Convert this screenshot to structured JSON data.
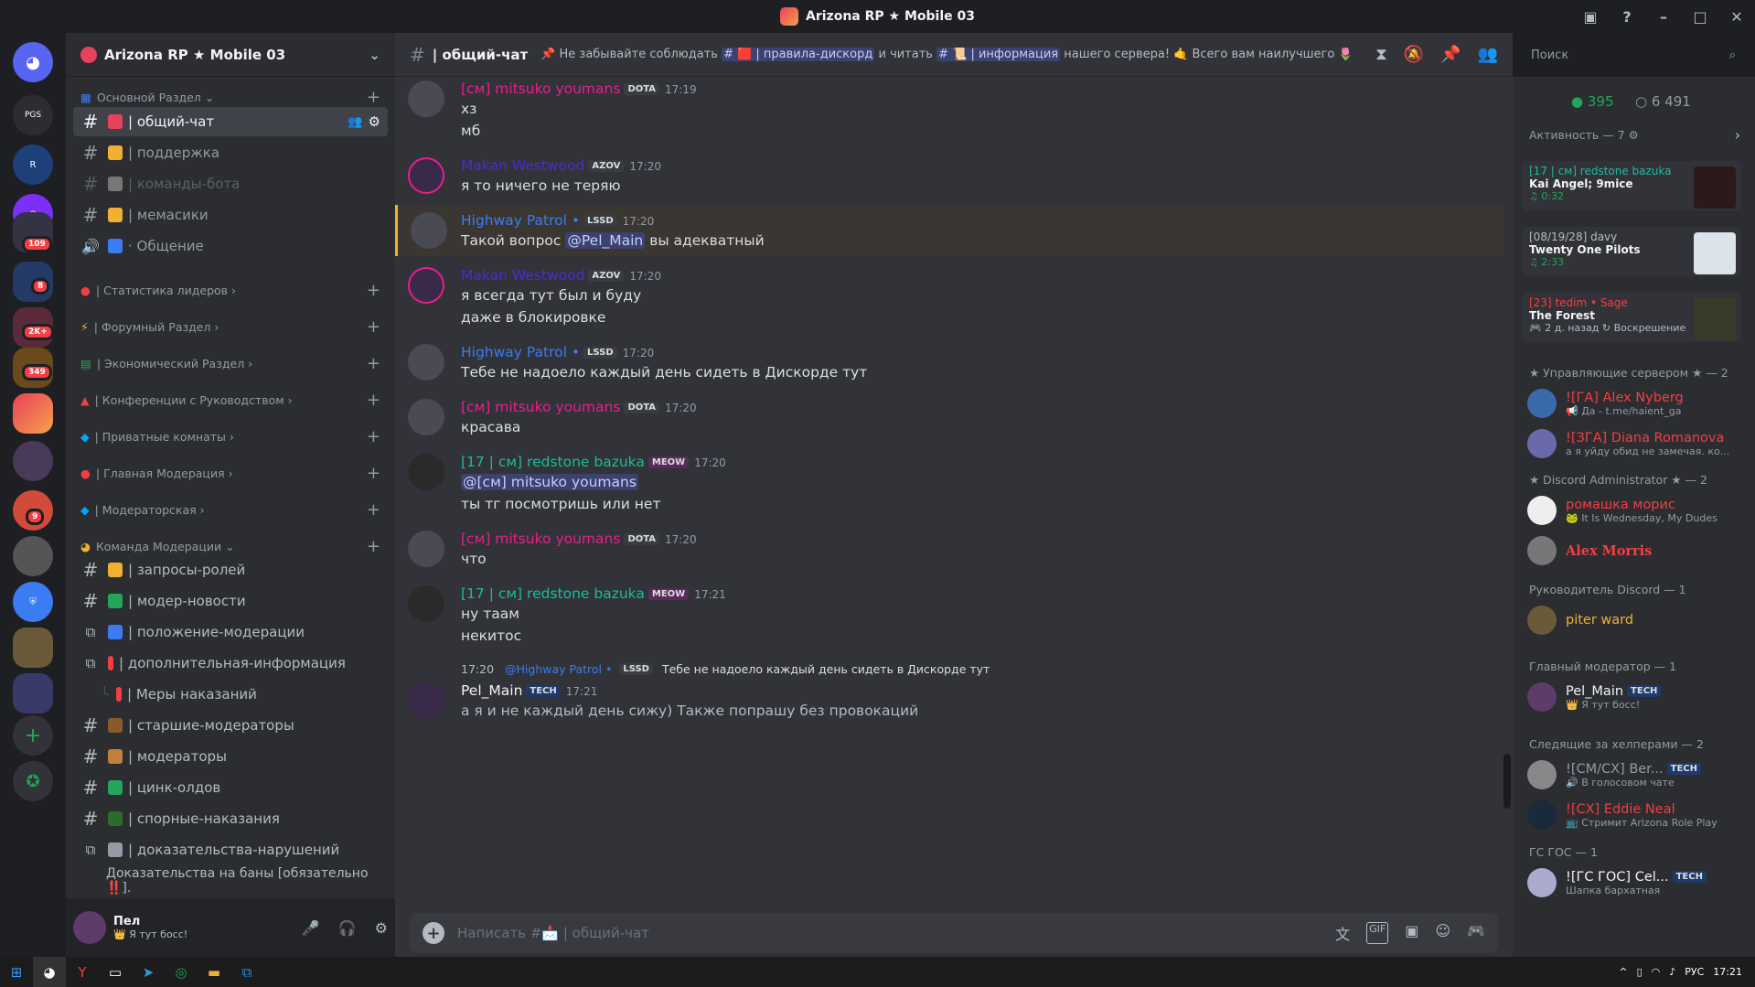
{
  "window": {
    "title": "Arizona RP ★ Mobile 03"
  },
  "guilds": {
    "badges": [
      "109",
      "8",
      "2K+",
      "349",
      "9"
    ],
    "top_label": "PGS"
  },
  "server": {
    "name": "Arizona RP ★ Mobile 03"
  },
  "sidebar": {
    "categories": [
      "Основной Раздел",
      "| Статистика лидеров",
      "| Форумный Раздел",
      "| Экономический Раздел",
      "| Конференции с Руководством",
      "| Приватные комнаты",
      "| Главная Модерация",
      "| Модераторская",
      "Команда Модерации"
    ],
    "channels": [
      "| общий-чат",
      "| поддержка",
      "| команды-бота",
      "| мемасики",
      "· Общение",
      "| запросы-ролей",
      "| модер-новости",
      "| положение-модерации",
      "| дополнительная-информация",
      "| Меры наказаний",
      "| старшие-модераторы",
      "| модераторы",
      "| цинк-олдов",
      "| спорные-наказания",
      "| доказательства-нарушений",
      "Доказательства на баны [обязательно ‼️]."
    ]
  },
  "userbar": {
    "name": "Пел",
    "status": "👑 Я тут босс!"
  },
  "chat": {
    "channel": "| общий-чат",
    "topic_prefix": "📌 Не забывайте соблюдать",
    "topic_rules": "# 🟥 | правила-дискорд",
    "topic_mid": "и читать",
    "topic_info": "# 📜 | информация",
    "topic_suffix": "нашего сервера! 🤙 Всего вам наилучшего 🌷",
    "placeholder": "Написать #📩 | общий-чат",
    "messages": [
      {
        "author": "[см] mitsuko youmans",
        "tag": "DOTA",
        "time": "17:19",
        "lines": [
          "хз",
          "мб"
        ]
      },
      {
        "author": "Makan Westwood",
        "tag": "AZOV",
        "time": "17:20",
        "lines": [
          "я то ничего не теряю"
        ]
      },
      {
        "author": "Highway Patrol •",
        "tag": "LSSD",
        "time": "17:20",
        "pre": "Такой вопрос",
        "mention": "@Pel_Main",
        "post": "вы адекватный"
      },
      {
        "author": "Makan Westwood",
        "tag": "AZOV",
        "time": "17:20",
        "lines": [
          "я всегда тут был и буду",
          "даже в блокировке"
        ]
      },
      {
        "author": "Highway Patrol •",
        "tag": "LSSD",
        "time": "17:20",
        "lines": [
          "Тебе не надоело каждый день сидеть в Дискорде тут"
        ]
      },
      {
        "author": "[см] mitsuko youmans",
        "tag": "DOTA",
        "time": "17:20",
        "lines": [
          "красава"
        ]
      },
      {
        "author": "[17 | см] redstone bazuka",
        "tag": "MEOW",
        "time": "17:20",
        "mention": "@[см] mitsuko youmans",
        "lines": [
          "ты тг посмотришь или нет"
        ]
      },
      {
        "author": "[см] mitsuko youmans",
        "tag": "DOTA",
        "time": "17:20",
        "lines": [
          "что"
        ]
      },
      {
        "author": "[17 | см] redstone bazuka",
        "tag": "MEOW",
        "time": "17:21",
        "lines": [
          "ну таам",
          "некитос"
        ]
      },
      {
        "author": "Pel_Main",
        "tag": "TECH",
        "time": "17:21",
        "reply_time": "17:20",
        "reply_author": "@Highway Patrol •",
        "reply_tag": "LSSD",
        "reply_text": "Тебе не надоело каждый день сидеть в Дискорде тут",
        "lines": [
          "а я и не каждый день сижу) Также попрашу без провокаций"
        ]
      }
    ]
  },
  "search": {
    "placeholder": "Поиск"
  },
  "members": {
    "online": "395",
    "total": "6 491",
    "activity_header": "Активность — 7",
    "activities": [
      {
        "who": "[17 | см] redstone bazuka",
        "what": "Kai Angel; 9mice",
        "extra": "♫ 0:32"
      },
      {
        "who": "[08/19/28] davy",
        "what": "Twenty One Pilots",
        "extra": "♫ 2:33"
      },
      {
        "who": "[23] tedim • Sage",
        "what": "The Forest",
        "extra": "🎮 2 д. назад  ↻ Воскрешение"
      }
    ],
    "groups": [
      {
        "header": "★ Управляющие сервером ★ — 2",
        "items": [
          {
            "name": "![ГА] Alex Nyberg",
            "status": "📢 Да - t.me/haient_ga",
            "color": "#f23f43"
          },
          {
            "name": "![ЗГА] Diana Romanova",
            "status": "а я уйду обид не замечая. ко...",
            "color": "#f23f43"
          }
        ]
      },
      {
        "header": "★ Discord Administrator ★ — 2",
        "items": [
          {
            "name": "ромашка морис",
            "status": "🐸 It Is Wednesday, My Dudes",
            "color": "#f23f43"
          },
          {
            "name": "Alex Morris",
            "status": "",
            "color": "#f23f43"
          }
        ]
      },
      {
        "header": "Руководитель Discord — 1",
        "items": [
          {
            "name": "piter ward",
            "status": "",
            "color": "#f0b132"
          }
        ]
      },
      {
        "header": "Главный модератор — 1",
        "items": [
          {
            "name": "Pel_Main",
            "status": "👑 Я тут босс!",
            "color": "#f2f3f5",
            "tag": "TECH"
          }
        ]
      },
      {
        "header": "Следящие за хелперами — 2",
        "items": [
          {
            "name": "![СМ/СХ] Ber...",
            "status": "🔊 В голосовом чате",
            "color": "#949ba4",
            "tag": "TECH"
          },
          {
            "name": "![СХ] Eddie Neal",
            "status": "📺 Стримит Arizona Role Play",
            "color": "#f23f43"
          }
        ]
      },
      {
        "header": "ГС ГОС — 1",
        "items": [
          {
            "name": "![ГС ГОС] Cel...",
            "status": "Шапка бархатная",
            "color": "#f2f3f5",
            "tag": "TECH"
          }
        ]
      }
    ]
  },
  "taskbar": {
    "lang": "РУС",
    "time": "17:21"
  },
  "colors": {
    "accent": "#5865f2",
    "pink": "#e91e8c",
    "blue": "#3b7cf2",
    "green": "#23a55a",
    "purple": "#7b2ff7",
    "red": "#f23f43"
  }
}
